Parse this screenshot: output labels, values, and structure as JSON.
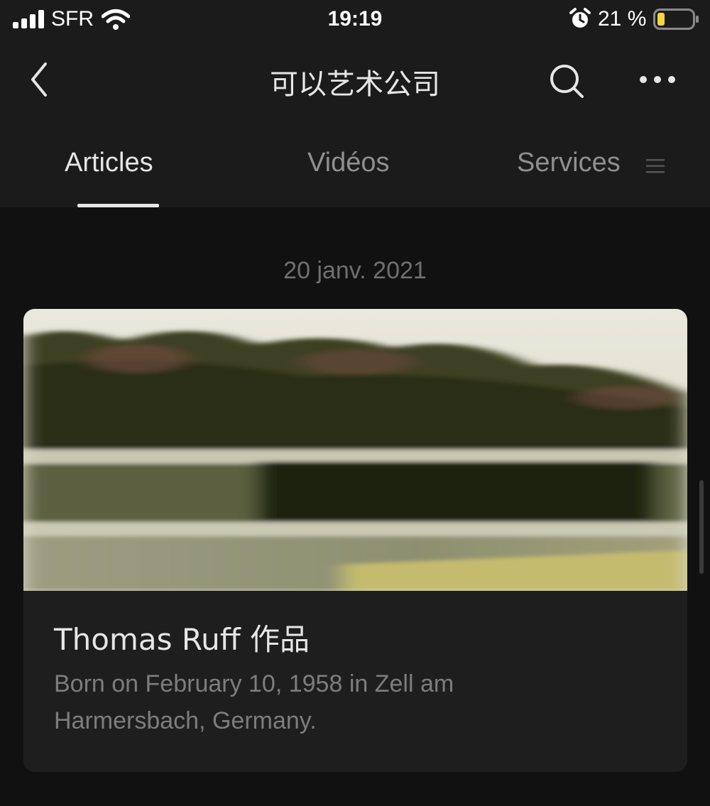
{
  "status_bar": {
    "carrier": "SFR",
    "time": "19:19",
    "battery_percent": "21 %",
    "battery_level": 0.21,
    "icons": [
      "signal-icon",
      "wifi-icon",
      "alarm-icon",
      "battery-icon"
    ]
  },
  "nav": {
    "title": "可以艺术公司",
    "icons": [
      "back-chevron-icon",
      "search-icon",
      "more-dots-icon"
    ]
  },
  "tabs": [
    {
      "label": "Articles",
      "active": true
    },
    {
      "label": "Vidéos",
      "active": false
    },
    {
      "label": "Services",
      "active": false
    }
  ],
  "feed": {
    "date": "20 janv. 2021",
    "article": {
      "title": "Thomas Ruff 作品",
      "description": "Born on February 10, 1958 in Zell am Harmersbach, Germany."
    }
  },
  "colors": {
    "background": "#111111",
    "bar": "#1b1b1b",
    "card": "#1e1e1e",
    "text_primary": "#e6e6e6",
    "text_secondary": "#7d7d7d",
    "battery_fill": "#f5d442"
  }
}
